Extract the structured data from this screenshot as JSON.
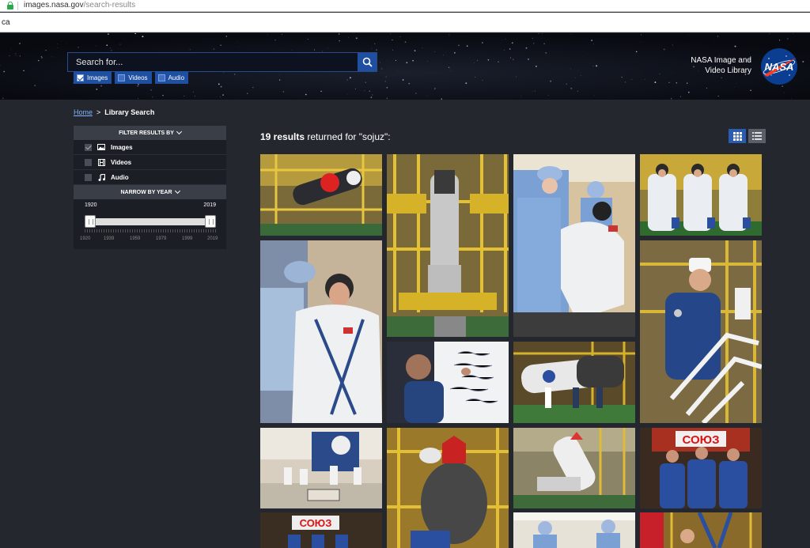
{
  "browser": {
    "url_domain": "images.nasa.gov",
    "url_path": "/search-results",
    "find_text": "ca"
  },
  "header": {
    "search_placeholder": "Search for...",
    "media": [
      {
        "label": "Images",
        "checked": true
      },
      {
        "label": "Videos",
        "checked": false
      },
      {
        "label": "Audio",
        "checked": false
      }
    ],
    "brand_line1": "NASA Image and",
    "brand_line2": "Video Library",
    "logo_text": "NASA"
  },
  "breadcrumb": {
    "home": "Home",
    "sep": ">",
    "current": "Library Search"
  },
  "filters": {
    "heading": "FILTER RESULTS BY",
    "items": [
      {
        "label": "Images",
        "checked": true,
        "icon": "image-icon"
      },
      {
        "label": "Videos",
        "checked": false,
        "icon": "film-icon"
      },
      {
        "label": "Audio",
        "checked": false,
        "icon": "music-note-icon"
      }
    ],
    "year_heading": "NARROW BY YEAR",
    "year_min": "1920",
    "year_max": "2019",
    "ticks": [
      "1920",
      "1939",
      "1959",
      "1979",
      "1999",
      "2019"
    ]
  },
  "results": {
    "count": "19 results",
    "suffix": " returned for \"sojuz\":",
    "view_modes": [
      "grid",
      "list"
    ]
  },
  "colors": {
    "accent": "#1f4fa0",
    "background": "#24272e",
    "panel": "#1b1e25"
  }
}
